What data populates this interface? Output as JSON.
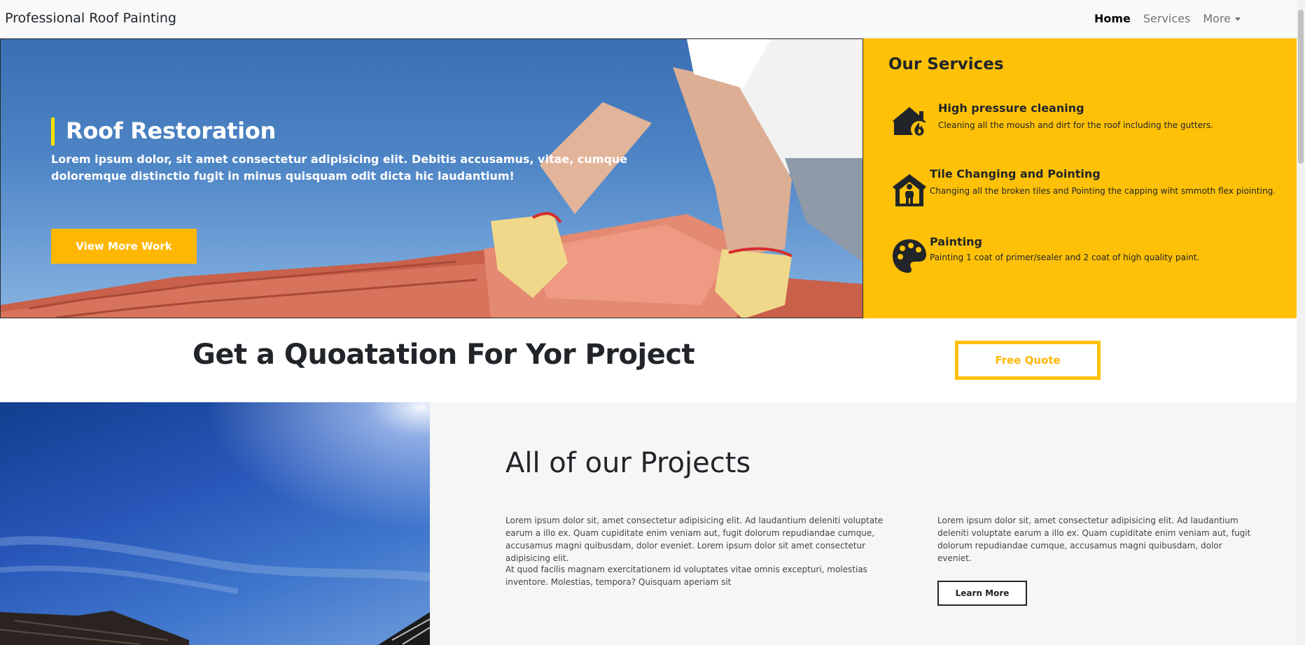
{
  "navbar": {
    "brand": "Professional Roof Painting",
    "links": [
      {
        "label": "Home",
        "active": true
      },
      {
        "label": "Services",
        "active": false
      },
      {
        "label": "More",
        "active": false,
        "dropdown": true
      }
    ]
  },
  "hero": {
    "title": "Roof Restoration",
    "text": "Lorem ipsum dolor, sit amet consectetur adipisicing elit. Debitis accusamus, vitae, cumque doloremque distinctio fugit in minus quisquam odit dicta hic laudantium!",
    "button_label": "View More Work"
  },
  "services": {
    "title": "Our Services",
    "items": [
      {
        "name": "High pressure cleaning",
        "desc": "Cleaning all the moush and dirt for the roof including the gutters.",
        "icon": "house-fire-icon"
      },
      {
        "name": "Tile Changing and Pointing",
        "desc": "Changing all the broken tiles and Pointing the capping wiht smmoth flex piointing.",
        "icon": "house-user-icon"
      },
      {
        "name": "Painting",
        "desc": "Painting 1 coat of primer/sealer and 2 coat of high quality paint.",
        "icon": "palette-icon"
      }
    ]
  },
  "quote": {
    "title": "Get a Quoatation For Yor Project",
    "button_label": "Free Quote"
  },
  "projects": {
    "title": "All of our Projects",
    "col1_p1": "Lorem ipsum dolor sit, amet consectetur adipisicing elit. Ad laudantium deleniti voluptate earum a illo ex. Quam cupiditate enim veniam aut, fugit dolorum repudiandae cumque, accusamus magni quibusdam, dolor eveniet. Lorem ipsum dolor sit amet consectetur adipisicing elit.",
    "col1_p2": "At quod facilis magnam exercitationem id voluptates vitae omnis excepturi, molestias inventore. Molestias, tempora? Quisquam aperiam sit",
    "col2_p1": "Lorem ipsum dolor sit, amet consectetur adipisicing elit. Ad laudantium deleniti voluptate earum a illo ex. Quam cupiditate enim veniam aut, fugit dolorum repudiandae cumque, accusamus magni quibusdam, dolor eveniet.",
    "learn_more": "Learn More"
  },
  "colors": {
    "accent": "#ffc107",
    "button_yellow": "#ffb703",
    "hero_bar": "#f6e100",
    "text_dark": "#212529"
  }
}
